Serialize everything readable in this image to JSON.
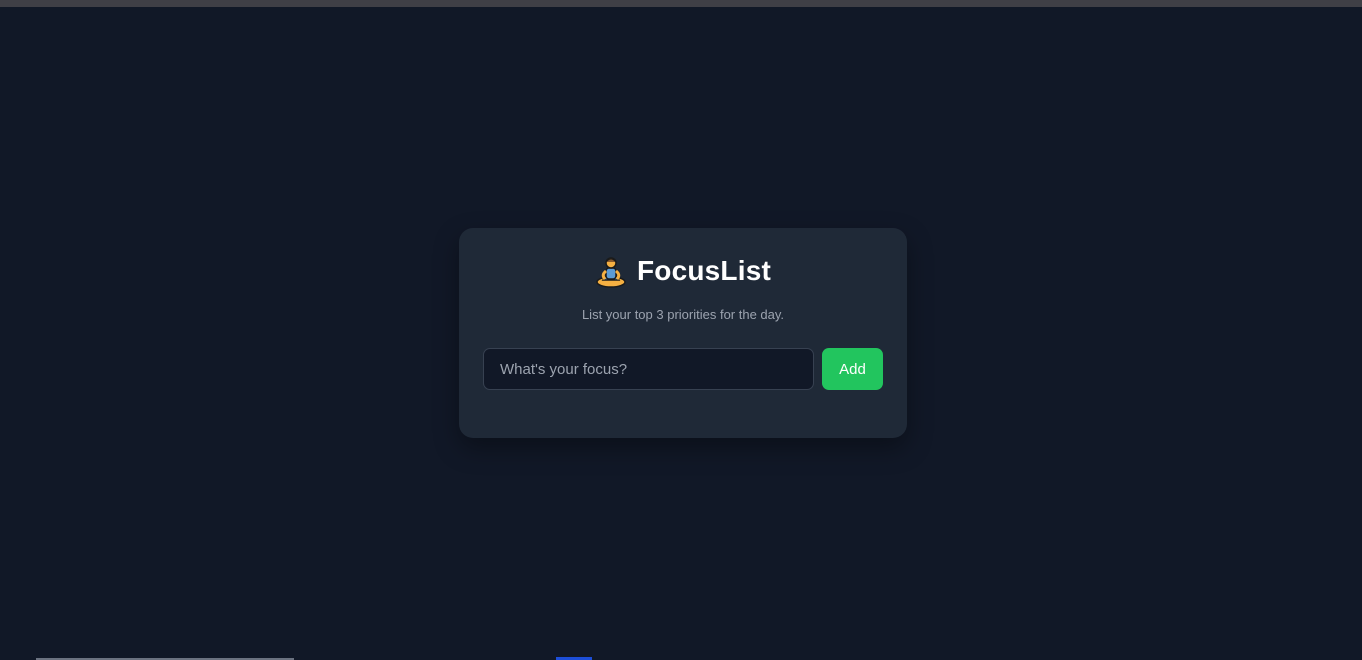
{
  "app": {
    "title": "FocusList",
    "icon": "meditating-person-icon",
    "subtitle": "List your top 3 priorities for the day."
  },
  "form": {
    "input_placeholder": "What's your focus?",
    "input_value": "",
    "add_label": "Add"
  },
  "colors": {
    "background": "#111827",
    "card": "#1f2937",
    "accent": "#22c55e"
  }
}
